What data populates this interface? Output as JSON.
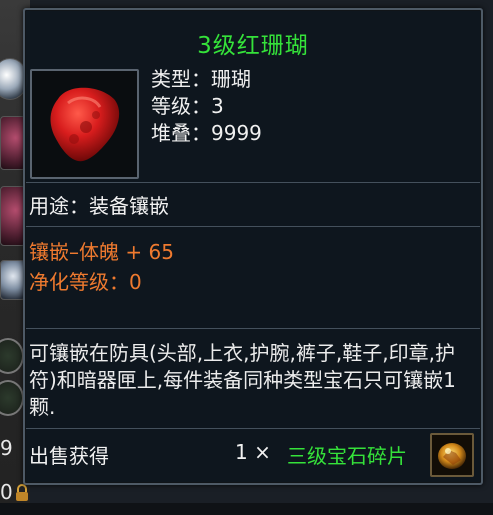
{
  "background": {
    "left_numbers": [
      "9",
      "0"
    ]
  },
  "tooltip": {
    "title": "3级红珊瑚",
    "info": {
      "type": "类型：珊瑚",
      "level": "等级：3",
      "stack": "堆叠：9999"
    },
    "usage": "用途：装备镶嵌",
    "attributes": {
      "inlay": "镶嵌–体魄 + 65",
      "purify": "净化等级：0"
    },
    "description": "可镶嵌在防具(头部,上衣,护腕,裤子,鞋子,印章,护符)和暗器匣上,每件装备同种类型宝石只可镶嵌1颗.",
    "sell": {
      "label": "出售获得",
      "quantity": "1 ×",
      "item": "三级宝石碎片"
    }
  },
  "colors": {
    "title": "#35e23a",
    "attribute": "#ef7a2f",
    "text": "#f0f0f0",
    "panel": "#0e161e"
  },
  "icons": [
    "red-coral-icon",
    "gem-fragment-icon",
    "lock-icon"
  ]
}
